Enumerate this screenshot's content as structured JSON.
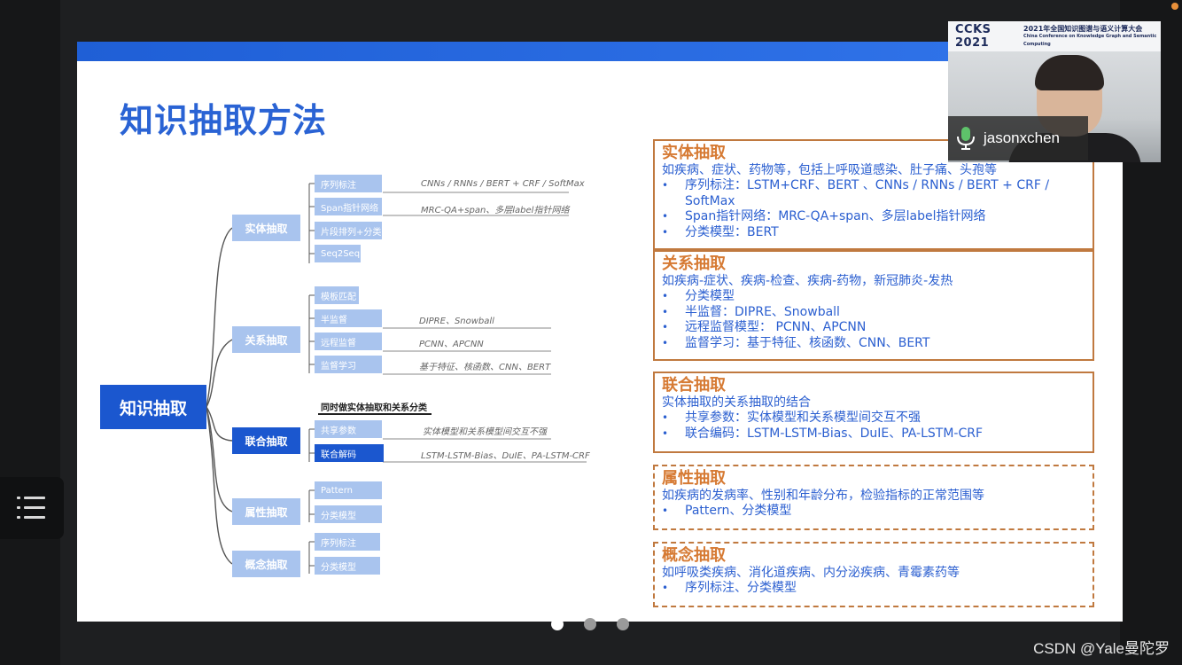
{
  "slide": {
    "title": "知识抽取方法",
    "mindmap": {
      "root": "知识抽取",
      "branches": [
        {
          "label": "实体抽取",
          "leaves": [
            {
              "label": "序列标注",
              "note": "CNNs / RNNs / BERT + CRF / SoftMax"
            },
            {
              "label": "Span指针网络",
              "note": "MRC-QA+span、多层label指针网络"
            },
            {
              "label": "片段排列+分类",
              "note": ""
            },
            {
              "label": "Seq2Seq",
              "note": ""
            }
          ]
        },
        {
          "label": "关系抽取",
          "leaves": [
            {
              "label": "模板匹配",
              "note": ""
            },
            {
              "label": "半监督",
              "note": "DIPRE、Snowball"
            },
            {
              "label": "远程监督",
              "note": "PCNN、APCNN"
            },
            {
              "label": "监督学习",
              "note": "基于特征、核函数、CNN、BERT"
            }
          ]
        },
        {
          "label": "联合抽取",
          "heading": "同时做实体抽取和关系分类",
          "leaves": [
            {
              "label": "共享参数",
              "note": "实体模型和关系模型间交互不强"
            },
            {
              "label": "联合解码",
              "note": "LSTM-LSTM-Bias、DuIE、PA-LSTM-CRF"
            }
          ]
        },
        {
          "label": "属性抽取",
          "leaves": [
            {
              "label": "Pattern",
              "note": ""
            },
            {
              "label": "分类模型",
              "note": ""
            }
          ]
        },
        {
          "label": "概念抽取",
          "leaves": [
            {
              "label": "序列标注",
              "note": ""
            },
            {
              "label": "分类模型",
              "note": ""
            }
          ]
        }
      ]
    },
    "boxes": [
      {
        "title": "实体抽取",
        "desc": "如疾病、症状、药物等，包括上呼吸道感染、肚子痛、头孢等",
        "items": [
          "序列标注：LSTM+CRF、BERT 、CNNs / RNNs / BERT + CRF / SoftMax",
          "Span指针网络：MRC-QA+span、多层label指针网络",
          "分类模型：BERT"
        ]
      },
      {
        "title": "关系抽取",
        "desc": "如疾病-症状、疾病-检查、疾病-药物，新冠肺炎-发热",
        "items": [
          "分类模型",
          "半监督：DIPRE、Snowball",
          "远程监督模型： PCNN、APCNN",
          "监督学习：基于特征、核函数、CNN、BERT"
        ]
      },
      {
        "title": "联合抽取",
        "desc": "实体抽取的关系抽取的结合",
        "items": [
          "共享参数：实体模型和关系模型间交互不强",
          "联合编码：LSTM-LSTM-Bias、DuIE、PA-LSTM-CRF"
        ]
      },
      {
        "title": "属性抽取",
        "desc": "如疾病的发病率、性别和年龄分布，检验指标的正常范围等",
        "items": [
          "Pattern、分类模型"
        ]
      },
      {
        "title": "概念抽取",
        "desc": "如呼吸类疾病、消化道疾病、内分泌疾病、青霉素药等",
        "items": [
          "序列标注、分类模型"
        ]
      }
    ]
  },
  "camera": {
    "logo": "CCKS 2021",
    "banner_line1": "2021年全国知识图谱与语义计算大会",
    "banner_line2": "China Conference on Knowledge Graph and Semantic Computing",
    "participant": "jasonxchen"
  },
  "watermark": "CSDN @Yale曼陀罗",
  "colors": {
    "accent_blue": "#1b57cf",
    "title_orange": "#d67a33",
    "box_border": "#c0793f"
  }
}
